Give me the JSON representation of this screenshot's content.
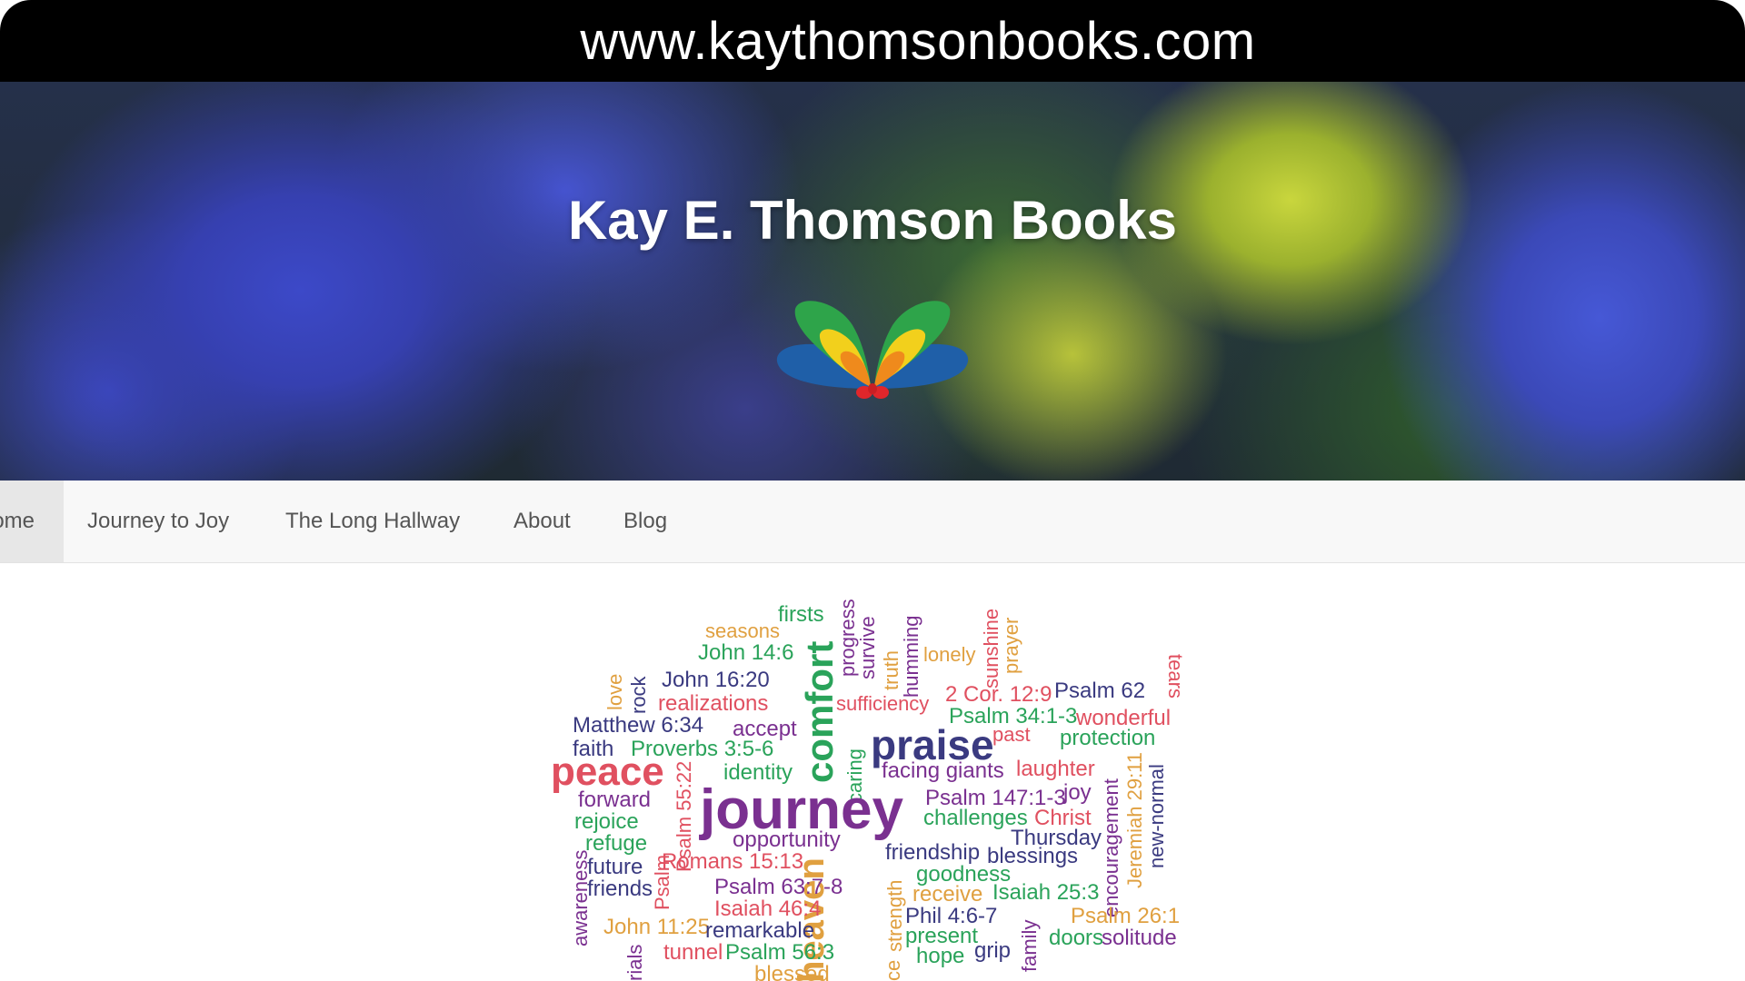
{
  "browser": {
    "url": "www.kaythomsonbooks.com"
  },
  "hero": {
    "title": "Kay E. Thomson Books",
    "logo_icon": "butterfly-logo-icon"
  },
  "nav": {
    "items": [
      {
        "label": "Home",
        "active": true
      },
      {
        "label": "Journey to Joy"
      },
      {
        "label": "The Long Hallway"
      },
      {
        "label": "About"
      },
      {
        "label": "Blog"
      }
    ]
  },
  "word_cloud": {
    "words": [
      "firsts",
      "seasons",
      "John 14:6",
      "progress",
      "survive",
      "truth",
      "humming",
      "sunshine",
      "prayer",
      "lonely",
      "love",
      "rock",
      "John 16:20",
      "realizations",
      "comfort",
      "sufficiency",
      "2 Cor. 12:9",
      "Psalm 62",
      "tears",
      "Psalm 34:1-3",
      "wonderful",
      "Matthew 6:34",
      "accept",
      "praise",
      "past",
      "protection",
      "faith",
      "Proverbs 3:5-6",
      "caring",
      "peace",
      "identity",
      "facing giants",
      "laughter",
      "encouragement",
      "Jeremiah 29:11",
      "new-normal",
      "forward",
      "journey",
      "Psalm 147:1-3",
      "joy",
      "rejoice",
      "Psalm 55:22",
      "challenges",
      "Christ",
      "Thursday",
      "refuge",
      "opportunity",
      "awareness",
      "future",
      "heaven",
      "friendship",
      "blessings",
      "Romans 15:13",
      "friends",
      "Psalm",
      "goodness",
      "Psalm 63:7-8",
      "strength",
      "receive",
      "Isaiah 25:3",
      "Isaiah 46:4",
      "Phil 4:6-7",
      "family",
      "Psalm 26:1",
      "John 11:25",
      "remarkable",
      "present",
      "doors",
      "solitude",
      "rials",
      "tunnel",
      "Psalm 56:3",
      "ce",
      "hope",
      "grip",
      "blessed"
    ]
  }
}
